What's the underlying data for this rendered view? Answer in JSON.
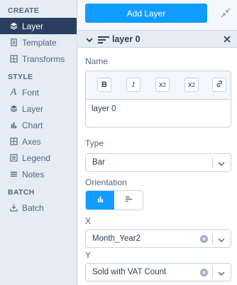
{
  "sidebar": {
    "sections": [
      {
        "title": "CREATE",
        "items": [
          {
            "label": "Layer",
            "icon": "layers-icon",
            "active": true
          },
          {
            "label": "Template",
            "icon": "document-icon"
          },
          {
            "label": "Transforms",
            "icon": "grid-icon"
          }
        ]
      },
      {
        "title": "STYLE",
        "items": [
          {
            "label": "Font",
            "icon": "font-icon"
          },
          {
            "label": "Layer",
            "icon": "layers-icon"
          },
          {
            "label": "Chart",
            "icon": "bar-chart-icon"
          },
          {
            "label": "Axes",
            "icon": "grid-icon"
          },
          {
            "label": "Legend",
            "icon": "legend-icon"
          },
          {
            "label": "Notes",
            "icon": "notes-icon"
          }
        ]
      },
      {
        "title": "BATCH",
        "items": [
          {
            "label": "Batch",
            "icon": "batch-icon"
          }
        ]
      }
    ]
  },
  "header": {
    "add_layer_label": "Add Layer"
  },
  "panel": {
    "title": "layer 0",
    "name_label": "Name",
    "editor": {
      "bold": "B",
      "italic": "I",
      "subscript": "x",
      "superscript": "x",
      "script_digit": "2",
      "text": "layer 0"
    },
    "type_label": "Type",
    "type_value": "Bar",
    "orientation_label": "Orientation",
    "orientation_selected": "vertical",
    "x_label": "X",
    "x_value": "Month_Year2",
    "y_label": "Y",
    "y_value": "Sold with VAT Count"
  },
  "colors": {
    "accent": "#119dff",
    "sidebar_active": "#2a3f5f",
    "sidebar_bg": "#e6ecf4"
  }
}
